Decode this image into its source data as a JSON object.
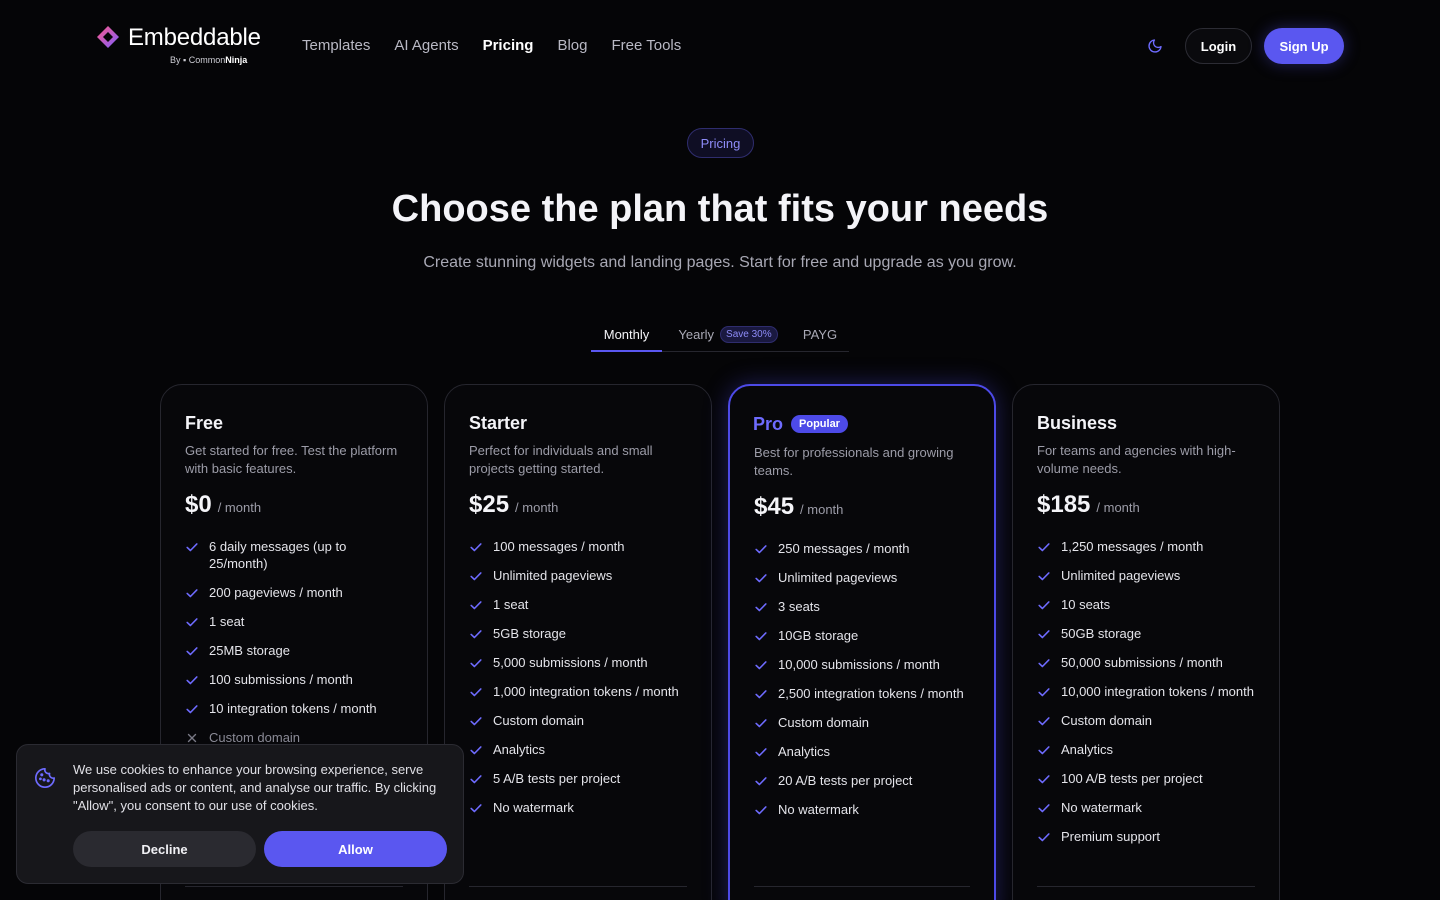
{
  "brand": {
    "name": "Embeddable",
    "by_prefix": "By",
    "by_name_a": "Common",
    "by_name_b": "Ninja",
    "colors": {
      "accent": "#5a57f0",
      "mark_top": "#ff5a8a",
      "mark_bottom": "#7b5cff"
    }
  },
  "nav": {
    "items": [
      {
        "label": "Templates",
        "active": false
      },
      {
        "label": "AI Agents",
        "active": false
      },
      {
        "label": "Pricing",
        "active": true
      },
      {
        "label": "Blog",
        "active": false
      },
      {
        "label": "Free Tools",
        "active": false
      }
    ],
    "theme_icon": "moon-icon",
    "login_label": "Login",
    "signup_label": "Sign Up"
  },
  "hero": {
    "eyebrow": "Pricing",
    "title": "Choose the plan that fits your needs",
    "subtitle": "Create stunning widgets and landing pages. Start for free and upgrade as you grow."
  },
  "billing": {
    "tabs": [
      {
        "label": "Monthly",
        "active": true
      },
      {
        "label": "Yearly",
        "badge": "Save 30%",
        "active": false
      },
      {
        "label": "PAYG",
        "active": false
      }
    ]
  },
  "plans": [
    {
      "name": "Free",
      "description": "Get started for free. Test the platform with basic features.",
      "price": "$0",
      "period": "/ month",
      "features": [
        {
          "text": "6 daily messages (up to 25/month)",
          "included": true
        },
        {
          "text": "200 pageviews / month",
          "included": true
        },
        {
          "text": "1 seat",
          "included": true
        },
        {
          "text": "25MB storage",
          "included": true
        },
        {
          "text": "100 submissions / month",
          "included": true
        },
        {
          "text": "10 integration tokens / month",
          "included": true
        },
        {
          "text": "Custom domain",
          "included": false
        }
      ]
    },
    {
      "name": "Starter",
      "description": "Perfect for individuals and small projects getting started.",
      "price": "$25",
      "period": "/ month",
      "features": [
        {
          "text": "100 messages / month",
          "included": true
        },
        {
          "text": "Unlimited pageviews",
          "included": true
        },
        {
          "text": "1 seat",
          "included": true
        },
        {
          "text": "5GB storage",
          "included": true
        },
        {
          "text": "5,000 submissions / month",
          "included": true
        },
        {
          "text": "1,000 integration tokens / month",
          "included": true
        },
        {
          "text": "Custom domain",
          "included": true
        },
        {
          "text": "Analytics",
          "included": true
        },
        {
          "text": "5 A/B tests per project",
          "included": true
        },
        {
          "text": "No watermark",
          "included": true
        }
      ]
    },
    {
      "name": "Pro",
      "badge": "Popular",
      "description": "Best for professionals and growing teams.",
      "price": "$45",
      "period": "/ month",
      "features": [
        {
          "text": "250 messages / month",
          "included": true
        },
        {
          "text": "Unlimited pageviews",
          "included": true
        },
        {
          "text": "3 seats",
          "included": true
        },
        {
          "text": "10GB storage",
          "included": true
        },
        {
          "text": "10,000 submissions / month",
          "included": true
        },
        {
          "text": "2,500 integration tokens / month",
          "included": true
        },
        {
          "text": "Custom domain",
          "included": true
        },
        {
          "text": "Analytics",
          "included": true
        },
        {
          "text": "20 A/B tests per project",
          "included": true
        },
        {
          "text": "No watermark",
          "included": true
        }
      ]
    },
    {
      "name": "Business",
      "description": "For teams and agencies with high-volume needs.",
      "price": "$185",
      "period": "/ month",
      "features": [
        {
          "text": "1,250 messages / month",
          "included": true
        },
        {
          "text": "Unlimited pageviews",
          "included": true
        },
        {
          "text": "10 seats",
          "included": true
        },
        {
          "text": "50GB storage",
          "included": true
        },
        {
          "text": "50,000 submissions / month",
          "included": true
        },
        {
          "text": "10,000 integration tokens / month",
          "included": true
        },
        {
          "text": "Custom domain",
          "included": true
        },
        {
          "text": "Analytics",
          "included": true
        },
        {
          "text": "100 A/B tests per project",
          "included": true
        },
        {
          "text": "No watermark",
          "included": true
        },
        {
          "text": "Premium support",
          "included": true
        }
      ]
    }
  ],
  "cookie": {
    "icon": "cookie-icon",
    "text": "We use cookies to enhance your browsing experience, serve personalised ads or content, and analyse our traffic. By clicking \"Allow\", you consent to our use of cookies.",
    "decline_label": "Decline",
    "allow_label": "Allow"
  }
}
